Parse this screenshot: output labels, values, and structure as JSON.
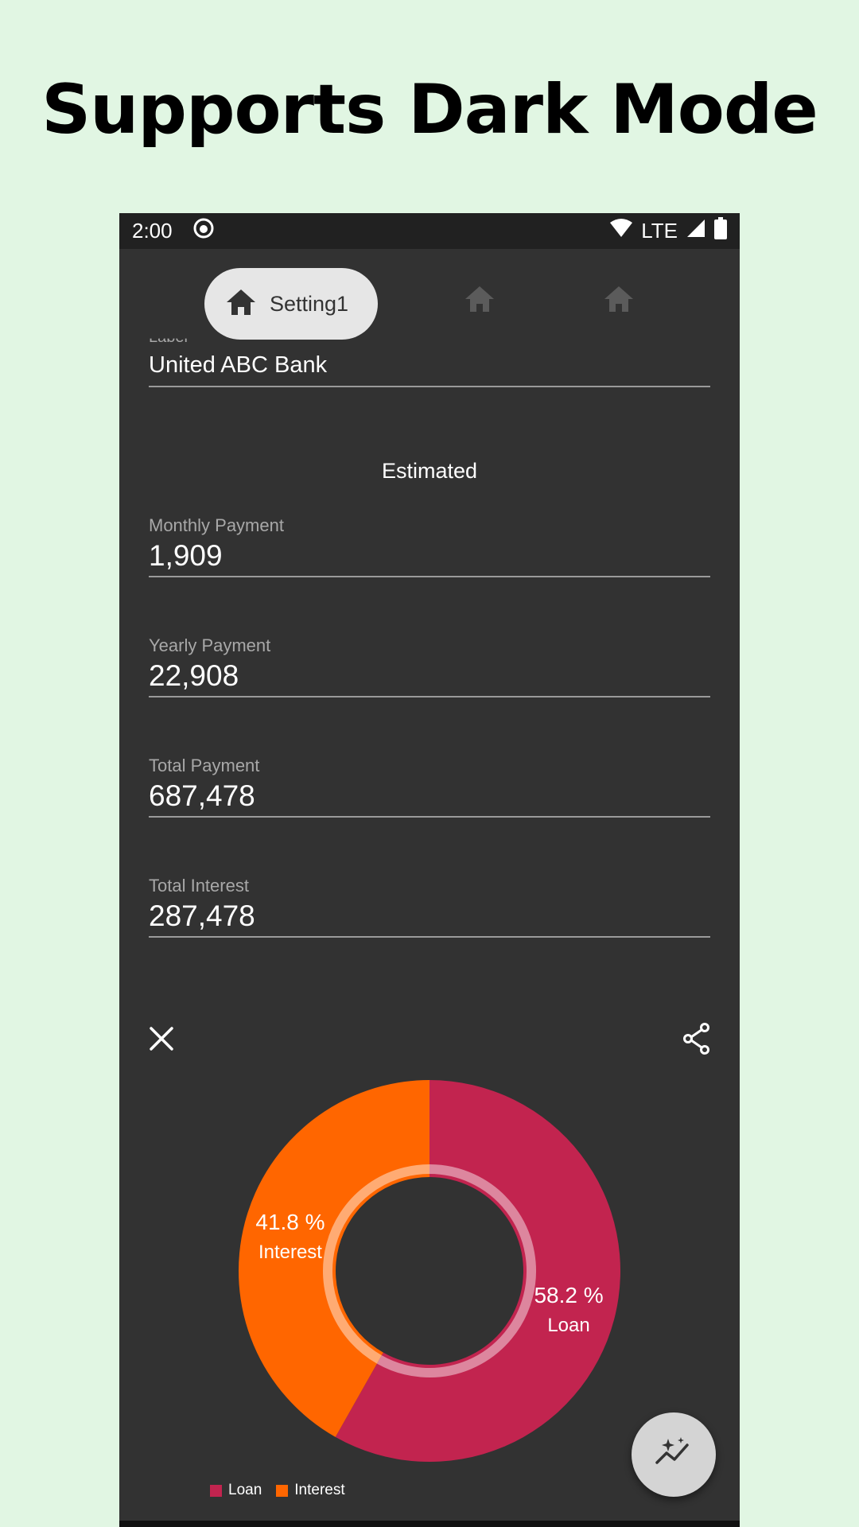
{
  "headline": "Supports Dark Mode",
  "status": {
    "time": "2:00",
    "network": "LTE"
  },
  "nav": {
    "active_label": "Setting1"
  },
  "form": {
    "label_field": {
      "label": "Label",
      "value": "United ABC Bank"
    },
    "section_title": "Estimated",
    "monthly": {
      "label": "Monthly Payment",
      "value": "1,909"
    },
    "yearly": {
      "label": "Yearly Payment",
      "value": "22,908"
    },
    "total_payment": {
      "label": "Total Payment",
      "value": "687,478"
    },
    "total_interest": {
      "label": "Total Interest",
      "value": "287,478"
    }
  },
  "chart_data": {
    "type": "pie",
    "series": [
      {
        "name": "Loan",
        "value": 58.2,
        "percent_label": "58.2 %",
        "color": "#c2244f"
      },
      {
        "name": "Interest",
        "value": 41.8,
        "percent_label": "41.8 %",
        "color": "#ff6600"
      }
    ],
    "legend": [
      "Loan",
      "Interest"
    ],
    "legend_position": "bottom-left"
  },
  "colors": {
    "background": "#e1f6e3",
    "surface": "#323232",
    "statusbar": "#212121"
  }
}
